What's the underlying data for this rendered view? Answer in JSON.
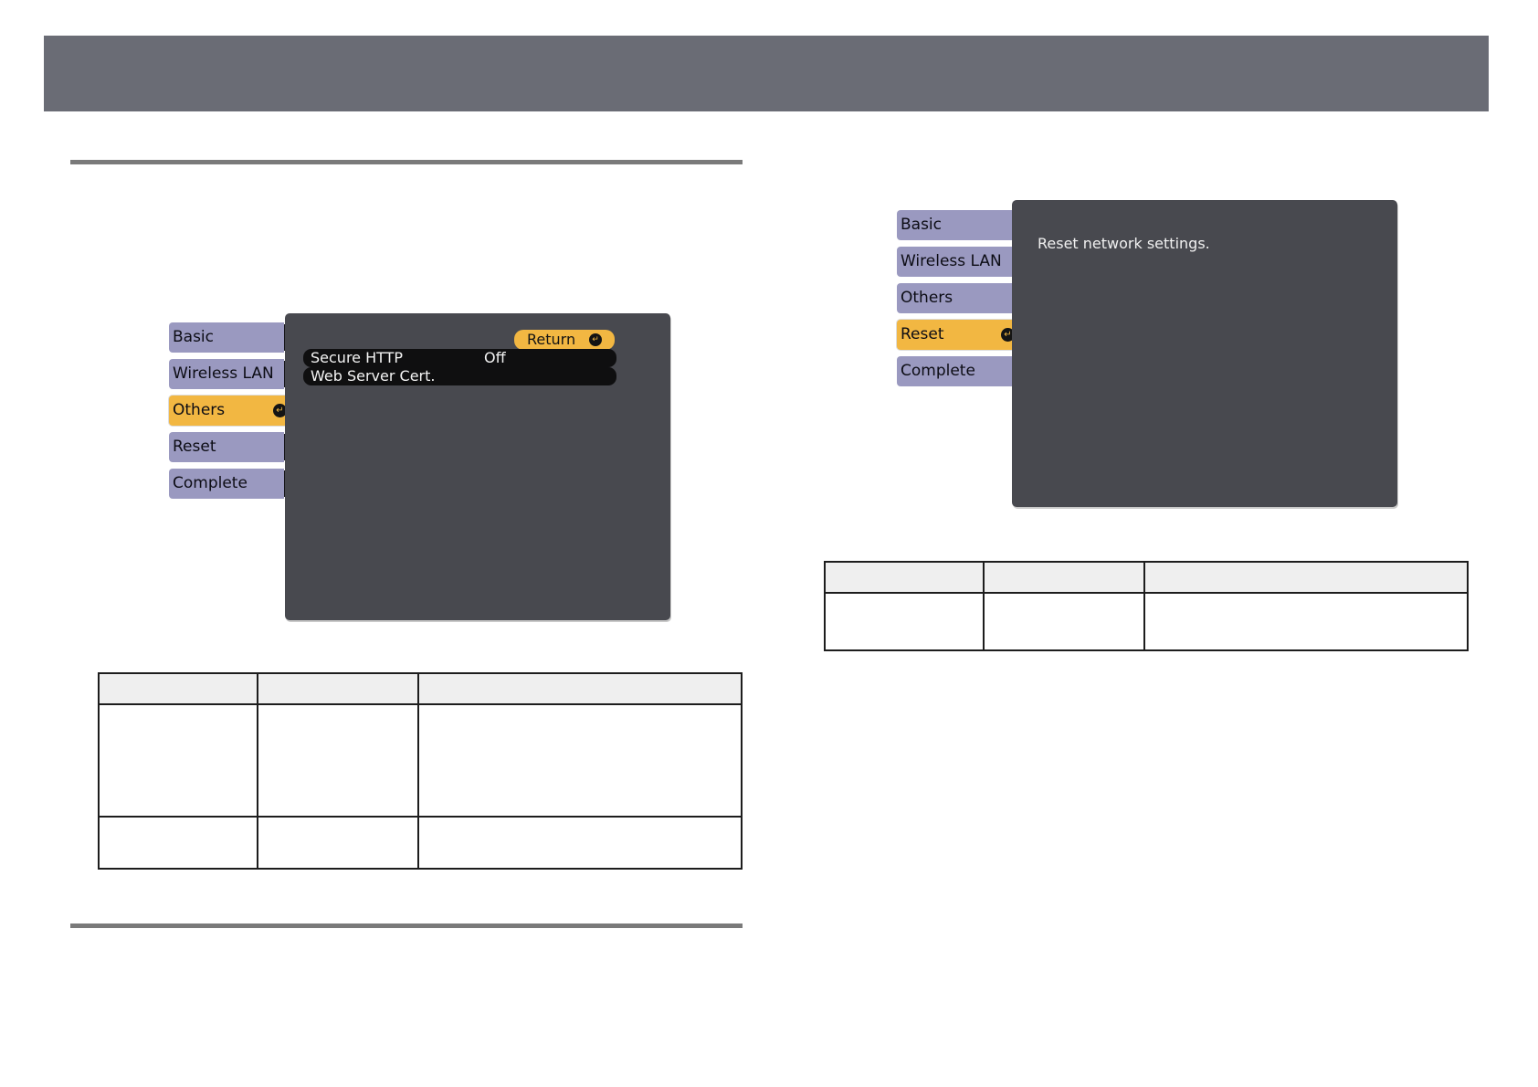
{
  "left_osd": {
    "tabs": [
      {
        "label": "Basic",
        "active": false
      },
      {
        "label": "Wireless LAN",
        "active": false
      },
      {
        "label": "Others",
        "active": true
      },
      {
        "label": "Reset",
        "active": false
      },
      {
        "label": "Complete",
        "active": false
      }
    ],
    "return_label": "Return",
    "options": [
      {
        "label": "Secure HTTP",
        "value": "Off"
      },
      {
        "label": "Web Server Cert.",
        "value": ""
      }
    ]
  },
  "right_osd": {
    "tabs": [
      {
        "label": "Basic",
        "active": false
      },
      {
        "label": "Wireless LAN",
        "active": false
      },
      {
        "label": "Others",
        "active": false
      },
      {
        "label": "Reset",
        "active": true
      },
      {
        "label": "Complete",
        "active": false
      }
    ],
    "message": "Reset network settings."
  },
  "colors": {
    "header": "#6a6c75",
    "tab": "#9a99c0",
    "active_tab": "#f2b742",
    "osd_panel": "#48494f"
  }
}
